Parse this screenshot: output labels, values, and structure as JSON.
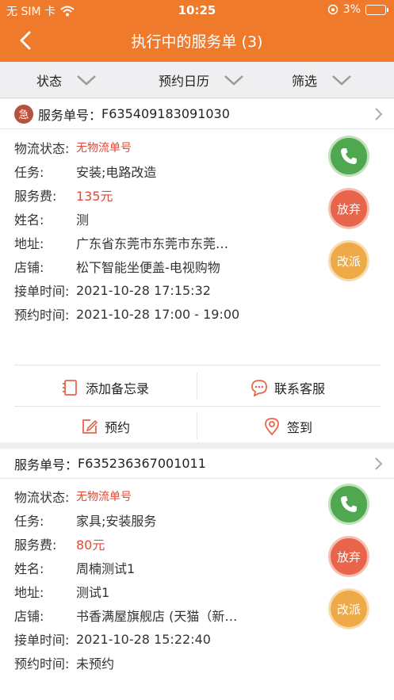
{
  "status_bar": {
    "carrier": "无 SIM 卡",
    "time": "10:25",
    "battery": "3%"
  },
  "nav": {
    "title": "执行中的服务单 (3)"
  },
  "filters": [
    {
      "label": "状态"
    },
    {
      "label": "预约日历"
    },
    {
      "label": "筛选"
    }
  ],
  "orders": [
    {
      "badge": "急",
      "order_label": "服务单号：",
      "order_no": "F635409183091030",
      "fields": [
        {
          "label": "物流状态:",
          "value": "无物流单号"
        },
        {
          "label": "任务:",
          "value": "安装;电路改造"
        },
        {
          "label": "服务费:",
          "value": "135元"
        },
        {
          "label": "姓名:",
          "value": "测"
        },
        {
          "label": "地址:",
          "value": "广东省东莞市东莞市东莞…"
        },
        {
          "label": "店铺:",
          "value": "松下智能坐便盖-电视购物"
        },
        {
          "label": "接单时间:",
          "value": "2021-10-28 17:15:32"
        },
        {
          "label": "预约时间:",
          "value": "2021-10-28 17:00 - 19:00"
        }
      ],
      "abandon_label": "放弃",
      "reassign_label": "改派",
      "actions": {
        "memo": "添加备忘录",
        "service": "联系客服",
        "appointment": "预约",
        "checkin": "签到"
      }
    },
    {
      "order_label": "服务单号：",
      "order_no": "F635236367001011",
      "fields": [
        {
          "label": "物流状态:",
          "value": "无物流单号"
        },
        {
          "label": "任务:",
          "value": "家具;安装服务"
        },
        {
          "label": "服务费:",
          "value": "80元"
        },
        {
          "label": "姓名:",
          "value": "周楠测试1"
        },
        {
          "label": "地址:",
          "value": "测试1"
        },
        {
          "label": "店铺:",
          "value": "书香满屋旗舰店 (天猫（新…"
        },
        {
          "label": "接单时间:",
          "value": "2021-10-28 15:22:40"
        },
        {
          "label": "预约时间:",
          "value": "未预约"
        }
      ],
      "abandon_label": "放弃",
      "reassign_label": "改派"
    }
  ],
  "colors": {
    "accent": "#ef7a2c",
    "call": "#4fa74f",
    "abandon": "#e8654b",
    "reassign": "#eeaa47",
    "price": "#e04a3a"
  }
}
